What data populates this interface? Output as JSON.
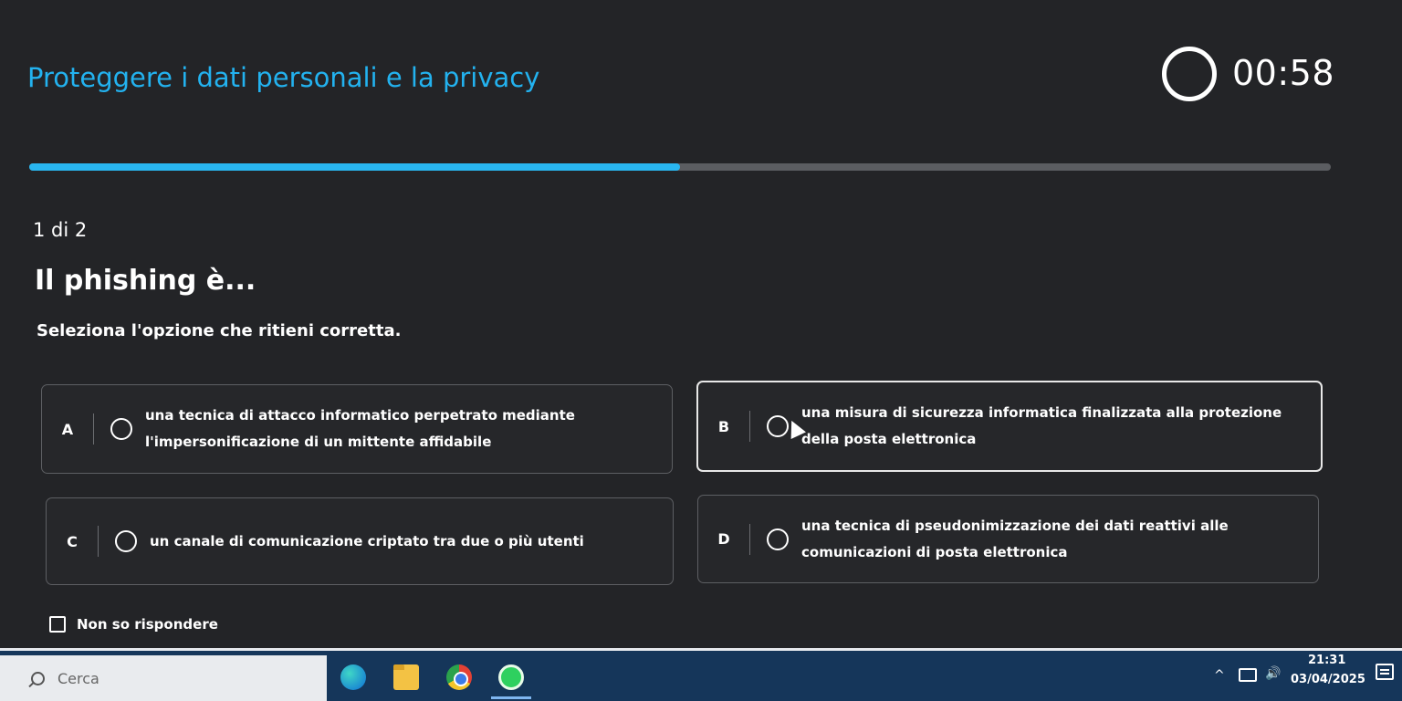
{
  "header": {
    "title": "Proteggere i dati personali e la privacy",
    "timer": "00:58"
  },
  "progress": {
    "fraction": 0.5,
    "color": "#29b6f0"
  },
  "quiz": {
    "step": "1 di 2",
    "question": "Il phishing è...",
    "instruction": "Seleziona l'opzione che ritieni corretta.",
    "options": [
      {
        "letter": "A",
        "text": "una tecnica di attacco informatico perpetrato mediante l'impersonificazione di un mittente affidabile"
      },
      {
        "letter": "B",
        "text": "una misura di sicurezza informatica finalizzata alla protezione della posta elettronica"
      },
      {
        "letter": "C",
        "text": "un canale di comunicazione criptato tra due o più utenti"
      },
      {
        "letter": "D",
        "text": "una tecnica di pseudonimizzazione dei dati reattivi alle comunicazioni di posta elettronica"
      }
    ],
    "dont_know": "Non so rispondere"
  },
  "taskbar": {
    "search_placeholder": "Cerca",
    "apps": [
      "edge-icon",
      "folder-icon",
      "chrome-icon",
      "whatsapp-icon"
    ],
    "time": "21:31",
    "date": "03/04/2025"
  }
}
